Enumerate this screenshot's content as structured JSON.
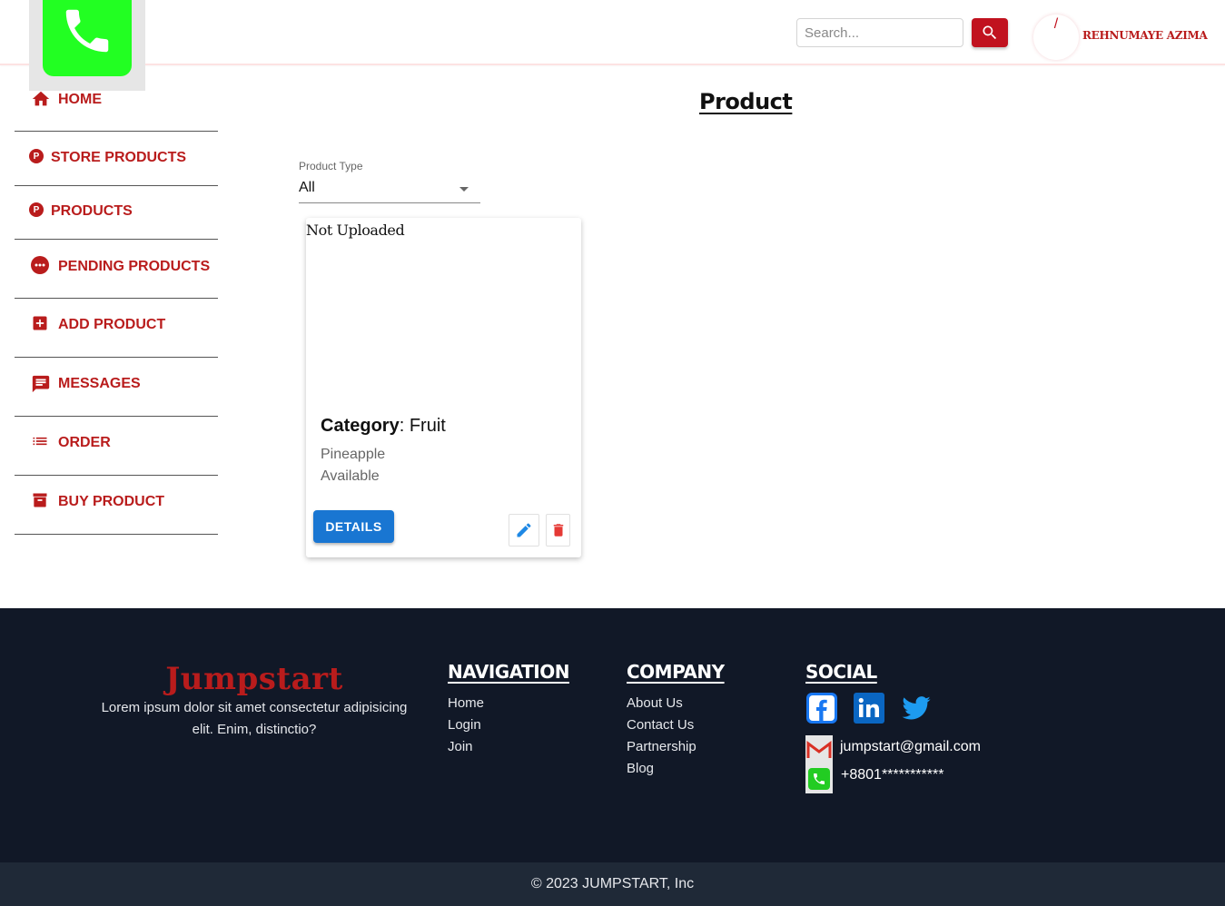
{
  "header": {
    "search_placeholder": "Search...",
    "avatar_initial": "/",
    "user_name": "REHNUMAYE AZIMA"
  },
  "sidebar": {
    "items": [
      {
        "label": "HOME",
        "icon": "home-icon"
      },
      {
        "label": "STORE PRODUCTS",
        "icon": "p-circle-icon"
      },
      {
        "label": "PRODUCTS",
        "icon": "p-circle-icon"
      },
      {
        "label": "PENDING PRODUCTS",
        "icon": "pending-icon"
      },
      {
        "label": "ADD PRODUCT",
        "icon": "add-box-icon"
      },
      {
        "label": "MESSAGES",
        "icon": "message-icon"
      },
      {
        "label": "ORDER",
        "icon": "list-icon"
      },
      {
        "label": "BUY PRODUCT",
        "icon": "archive-icon"
      }
    ]
  },
  "main": {
    "title": "Product",
    "filter": {
      "label": "Product Type",
      "value": "All"
    },
    "card": {
      "image_alt": "Not Uploaded",
      "category_label": "Category",
      "category_value": ": Fruit",
      "name": "Pineapple",
      "status": "Available",
      "details_label": "DETAILS"
    }
  },
  "footer": {
    "brand": "Jumpstart",
    "description": "Lorem ipsum dolor sit amet consectetur adipisicing elit. Enim, distinctio?",
    "navigation": {
      "title": "NAVIGATION",
      "links": [
        "Home",
        "Login",
        "Join"
      ]
    },
    "company": {
      "title": "COMPANY",
      "links": [
        "About Us",
        "Contact Us",
        "Partnership",
        "Blog"
      ]
    },
    "social": {
      "title": "SOCIAL",
      "email": "jumpstart@gmail.com",
      "phone": "+8801***********"
    },
    "copyright": "© 2023 JUMPSTART, Inc"
  },
  "colors": {
    "accent": "#b91c1c",
    "button_red": "#c1121f",
    "primary_blue": "#1976d2",
    "footer_bg": "#111827",
    "copyright_bg": "#1f2937"
  }
}
